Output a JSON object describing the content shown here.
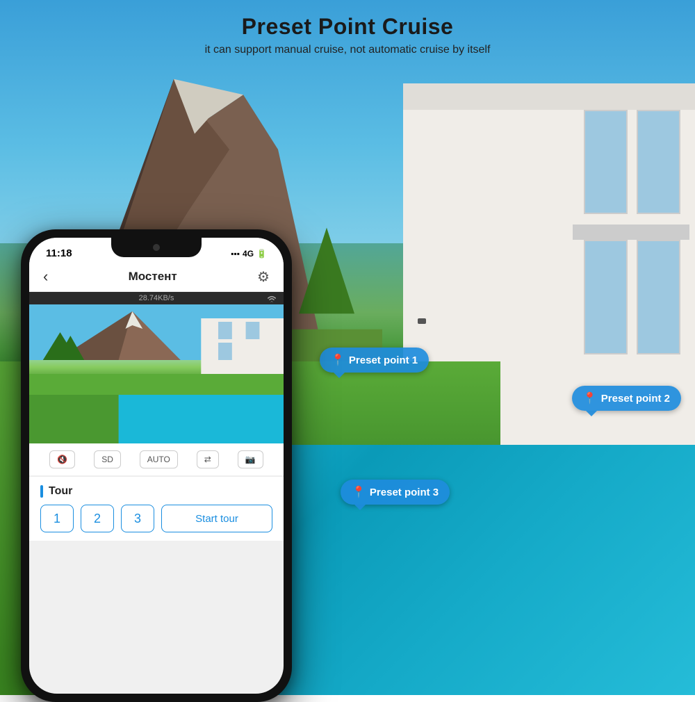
{
  "header": {
    "title": "Preset Point Cruise",
    "subtitle": "it can support manual cruise, not automatic cruise by itself"
  },
  "presets": [
    {
      "id": "preset1",
      "label": "Preset point 1"
    },
    {
      "id": "preset2",
      "label": "Preset point 2"
    },
    {
      "id": "preset3",
      "label": "Preset point 3"
    }
  ],
  "phone": {
    "status_bar": {
      "time": "11:18",
      "signal": "▪▪▪",
      "network": "4G",
      "battery": "🔋"
    },
    "nav": {
      "back_icon": "‹",
      "title": "Мостент",
      "settings_icon": "⚙"
    },
    "bandwidth": "28.74KB/s",
    "wifi_icon": "WiFi",
    "controls": [
      {
        "label": "🔇"
      },
      {
        "label": "SD"
      },
      {
        "label": "AUTO"
      },
      {
        "label": "⇄"
      },
      {
        "label": "📷"
      }
    ],
    "tour_section": {
      "label": "Tour",
      "buttons": [
        "1",
        "2",
        "3"
      ],
      "start_tour_label": "Start tour"
    }
  }
}
